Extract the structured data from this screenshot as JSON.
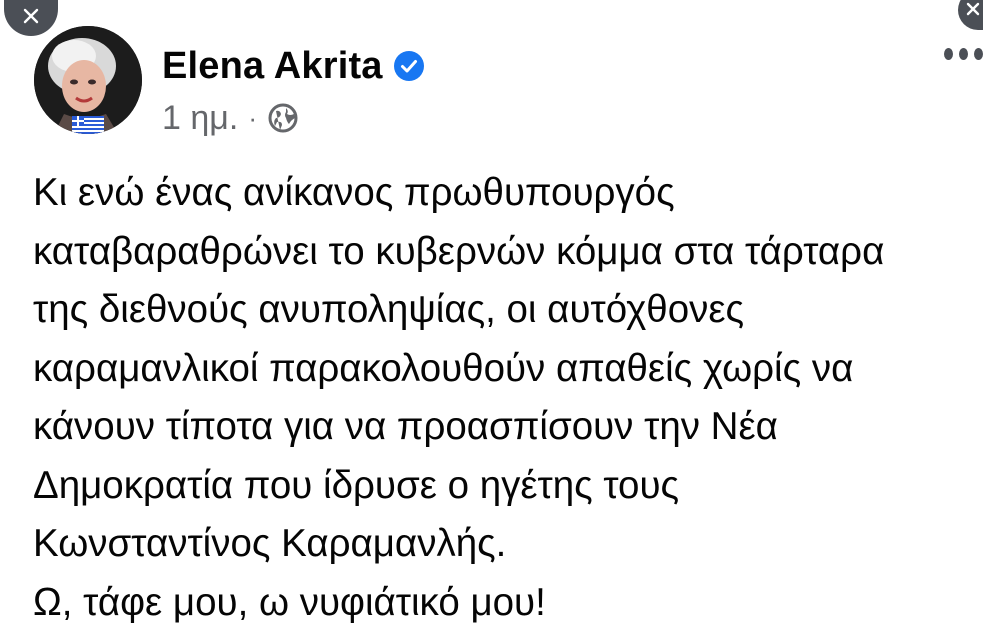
{
  "post": {
    "author": "Elena Akrita",
    "verified": true,
    "timestamp": "1 ημ.",
    "separator": "·",
    "audience_icon": "globe-icon",
    "body_lines": [
      "Κι ενώ ένας ανίκανος πρωθυπουργός",
      "καταβαραθρώνει το κυβερνών κόμμα στα τάρταρα",
      "της διεθνούς ανυποληψίας, οι αυτόχθονες",
      "καραμανλικοί παρακολουθούν απαθείς χωρίς να",
      "κάνουν τίποτα για να προασπίσουν την Νέα",
      "Δημοκρατία που ίδρυσε ο ηγέτης τους",
      "Κωνσταντίνος Καραμανλής.",
      "Ω, τάφε μου, ω νυφιάτικό μου!"
    ]
  },
  "icons": {
    "close": "close-icon",
    "more": "more-options-icon",
    "verified": "verified-badge-icon"
  },
  "colors": {
    "verified_blue": "#1877f2",
    "meta_gray": "#65676b",
    "text": "#050505",
    "dark_button": "#4b4f56"
  }
}
